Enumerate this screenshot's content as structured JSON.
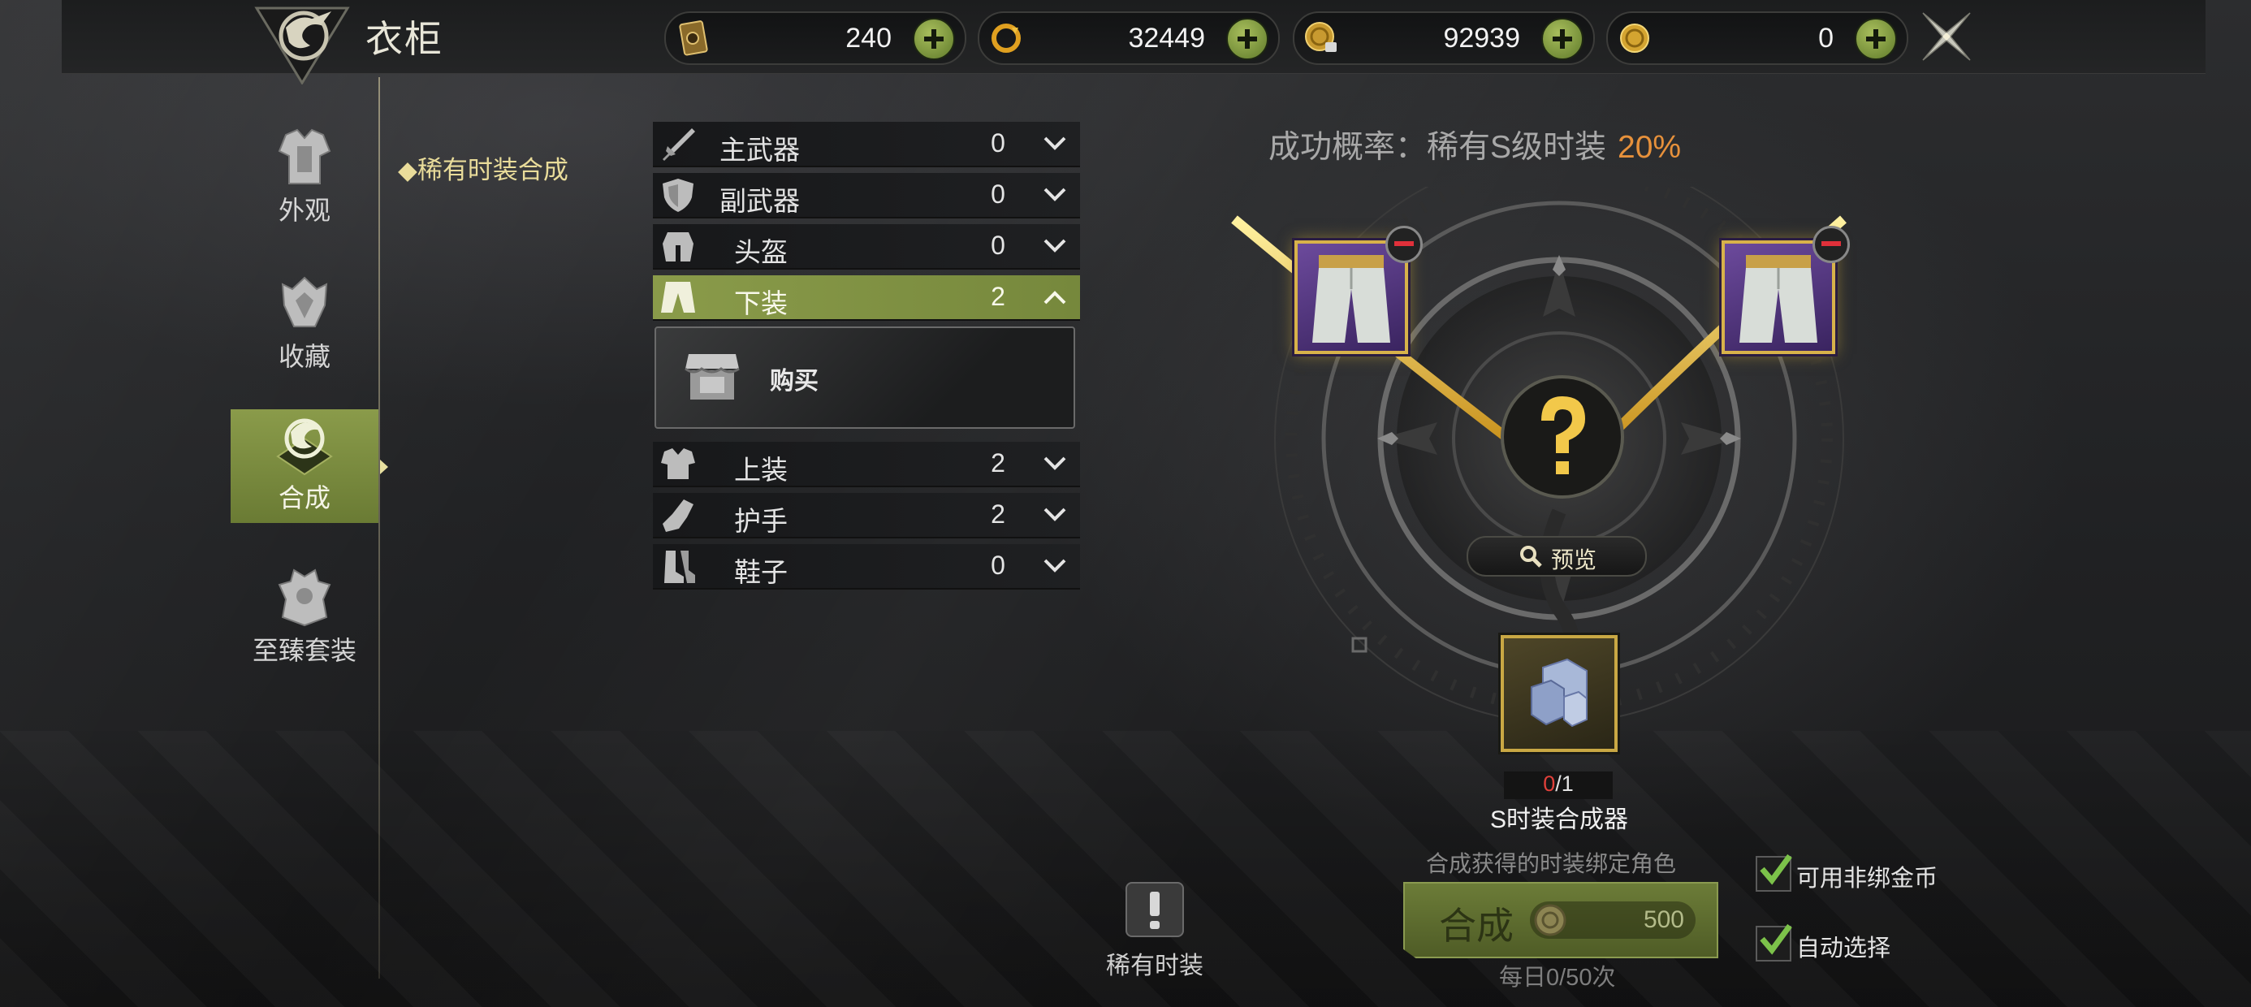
{
  "header": {
    "title": "衣柜",
    "currencies": [
      {
        "icon": "card-ticket-icon",
        "value": "240"
      },
      {
        "icon": "crystal-swirl-icon",
        "value": "32449"
      },
      {
        "icon": "locked-gold-coin-icon",
        "value": "92939"
      },
      {
        "icon": "gold-coin-icon",
        "value": "0"
      }
    ]
  },
  "sidebar": {
    "items": [
      {
        "label": "外观",
        "icon": "armor-icon",
        "active": false
      },
      {
        "label": "收藏",
        "icon": "collection-icon",
        "active": false
      },
      {
        "label": "合成",
        "icon": "dragon-icon",
        "active": true
      },
      {
        "label": "至臻套装",
        "icon": "set-armor-icon",
        "active": false
      }
    ],
    "subnav": "稀有时装合成"
  },
  "categories": [
    {
      "name": "主武器",
      "count": "0",
      "icon": "sword-icon",
      "expanded": false
    },
    {
      "name": "副武器",
      "count": "0",
      "icon": "shield-icon",
      "expanded": false
    },
    {
      "name": "头盔",
      "count": "0",
      "icon": "helmet-icon",
      "expanded": false
    },
    {
      "name": "下装",
      "count": "2",
      "icon": "pants-icon",
      "expanded": true
    },
    {
      "name": "上装",
      "count": "2",
      "icon": "chest-armor-icon",
      "expanded": false
    },
    {
      "name": "护手",
      "count": "2",
      "icon": "gauntlet-icon",
      "expanded": false
    },
    {
      "name": "鞋子",
      "count": "0",
      "icon": "boots-icon",
      "expanded": false
    }
  ],
  "buy": {
    "label": "购买",
    "icon": "shop-icon"
  },
  "synthesis": {
    "rate_label": "成功概率：稀有S级时装",
    "rate_value": "20%",
    "preview_label": "预览",
    "material_current": "0",
    "material_total": "/1",
    "material_name": "S时装合成器",
    "bind_note": "合成获得的时装绑定角色",
    "button_label": "合成",
    "cost": "500",
    "daily_limit": "每日0/50次",
    "options": [
      {
        "label": "可用非绑金币",
        "checked": true
      },
      {
        "label": "自动选择",
        "checked": true
      }
    ]
  },
  "rare_button": {
    "label": "稀有时装"
  },
  "colors": {
    "accent_green": "#8a9b4a",
    "gold": "#d8b24a",
    "rate_orange": "#e7913b",
    "slot_purple": "#6c4a9c",
    "count_red": "#e0403a"
  }
}
